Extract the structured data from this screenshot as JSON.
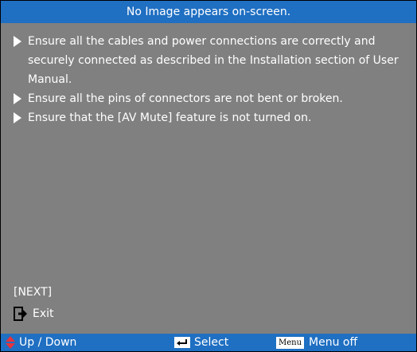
{
  "header": {
    "title": "No Image appears on-screen."
  },
  "tips": [
    "Ensure all the cables and power connections are correctly and securely connected as described in the Installation section of User Manual.",
    "Ensure all the pins of connectors are not bent or broken.",
    "Ensure that the [AV Mute] feature is not turned on."
  ],
  "navigation": {
    "next_label": "[NEXT]",
    "exit_label": "Exit"
  },
  "footer": {
    "up_down_label": "Up / Down",
    "select_label": "Select",
    "menu_key_label": "Menu",
    "menu_off_label": "Menu off"
  },
  "colors": {
    "bar": "#1f6fc2",
    "panel": "#808080",
    "text": "#ffffff",
    "arrow_red": "#e8323c"
  },
  "icons": {
    "bullet": "triangle-right-icon",
    "exit": "exit-icon",
    "up_down": "up-down-arrows-icon",
    "select": "enter-key-icon"
  }
}
